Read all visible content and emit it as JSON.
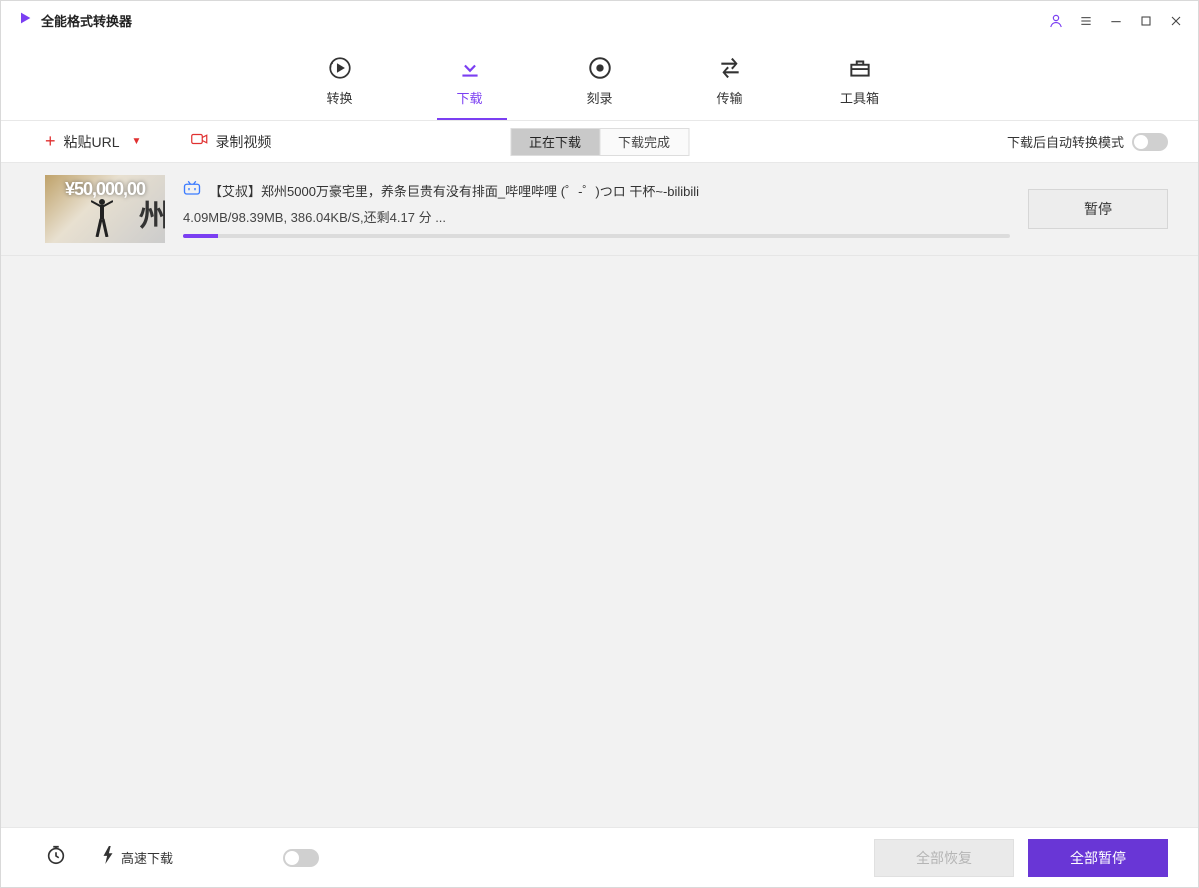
{
  "titlebar": {
    "app_title": "全能格式转换器"
  },
  "nav": {
    "items": [
      {
        "label": "转换"
      },
      {
        "label": "下载"
      },
      {
        "label": "刻录"
      },
      {
        "label": "传输"
      },
      {
        "label": "工具箱"
      }
    ],
    "active_index": 1
  },
  "toolbar": {
    "paste_label": "粘贴URL",
    "record_label": "录制视频",
    "tabs": [
      {
        "label": "正在下载"
      },
      {
        "label": "下载完成"
      }
    ],
    "active_tab": 0,
    "auto_convert_label": "下载后自动转换模式",
    "auto_convert_on": false
  },
  "downloads": [
    {
      "thumb_text": "¥50,000,00",
      "source": "bilibili",
      "title": "【艾叔】郑州5000万豪宅里，养条巨贵有没有排面_哔哩哔哩 (゜-゜)つロ 干杯~-bilibili",
      "status": "4.09MB/98.39MB, 386.04KB/S,还剩4.17 分  ...",
      "progress_pct": 4.2,
      "button_label": "暂停"
    }
  ],
  "footer": {
    "highspeed_label": "高速下载",
    "highspeed_on": false,
    "resume_all_label": "全部恢复",
    "pause_all_label": "全部暂停"
  }
}
